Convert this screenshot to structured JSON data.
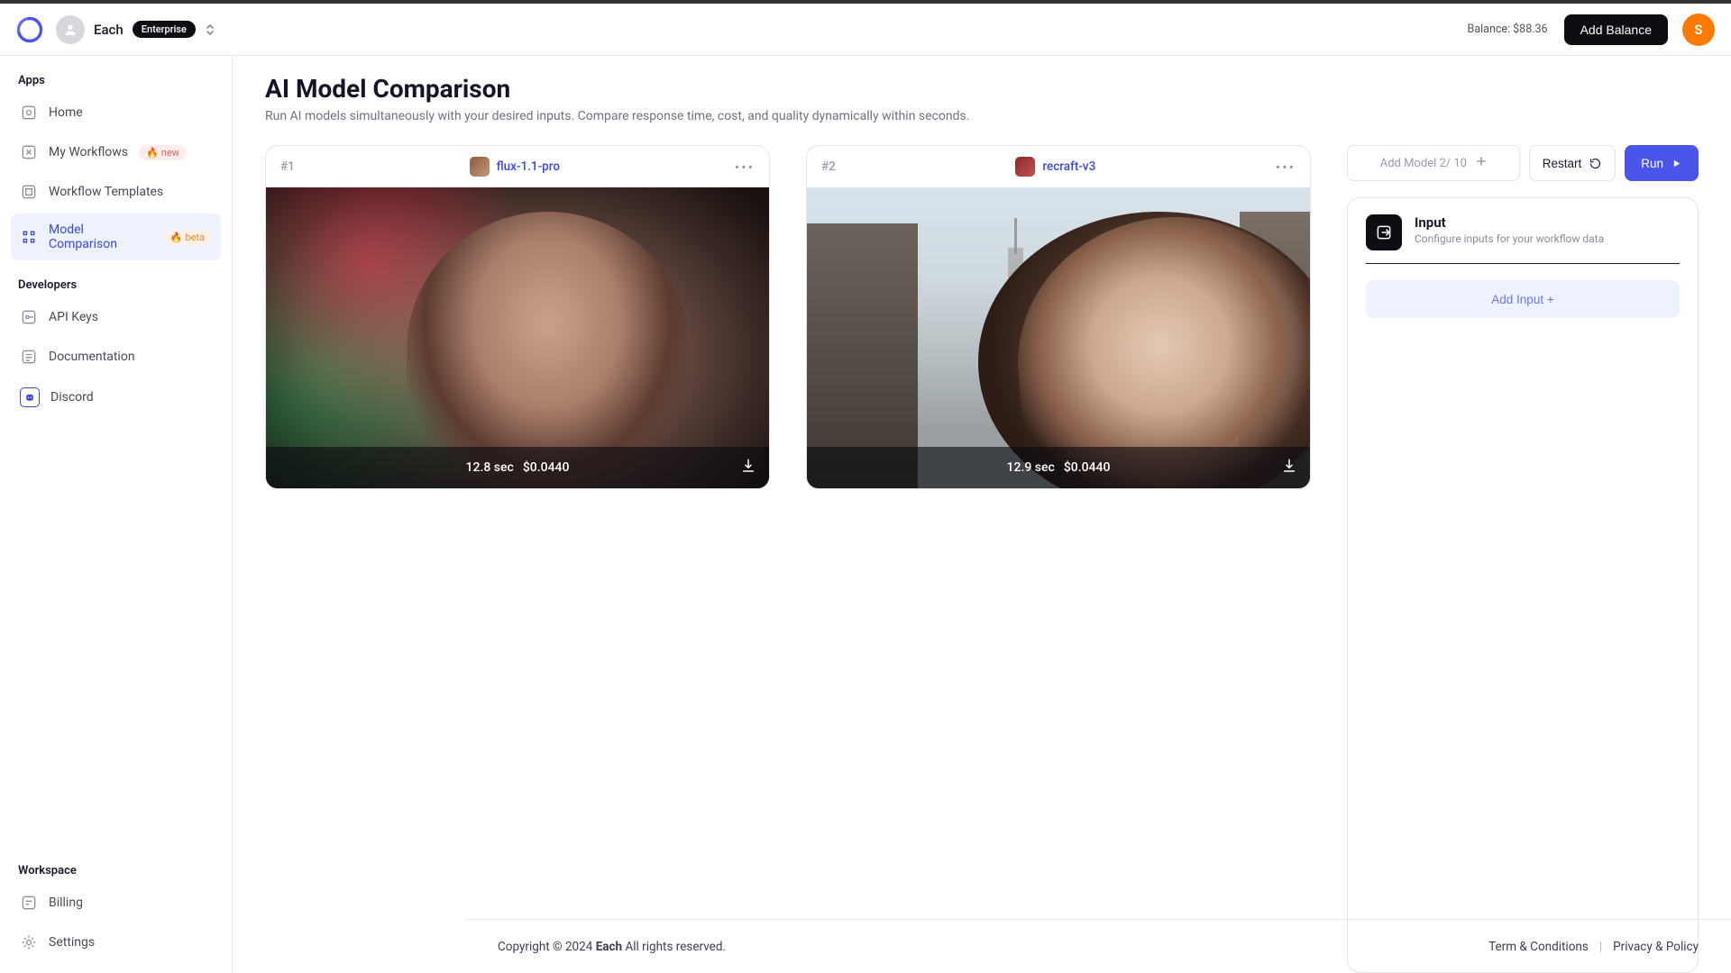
{
  "header": {
    "workspace_name": "Each",
    "plan_badge": "Enterprise",
    "balance_label": "Balance: $88.36",
    "add_balance_label": "Add Balance",
    "avatar_letter": "S",
    "avatar_color": "#ff7a00"
  },
  "sidebar": {
    "sections": {
      "apps_title": "Apps",
      "developers_title": "Developers",
      "workspace_title": "Workspace"
    },
    "items": {
      "home": "Home",
      "my_workflows": "My Workflows",
      "my_workflows_tag": "new",
      "workflow_templates": "Workflow Templates",
      "model_comparison": "Model Comparison",
      "model_comparison_tag": "beta",
      "api_keys": "API Keys",
      "documentation": "Documentation",
      "discord": "Discord",
      "billing": "Billing",
      "settings": "Settings"
    }
  },
  "page": {
    "title": "AI Model Comparison",
    "subtitle": "Run AI models simultaneously with your desired inputs. Compare response time, cost, and quality dynamically within seconds."
  },
  "cards": [
    {
      "index": "#1",
      "model_name": "flux-1.1-pro",
      "time": "12.8 sec",
      "cost": "$0.0440"
    },
    {
      "index": "#2",
      "model_name": "recraft-v3",
      "time": "12.9 sec",
      "cost": "$0.0440"
    }
  ],
  "right_panel": {
    "add_model_label": "Add Model 2/ 10",
    "restart_label": "Restart",
    "run_label": "Run",
    "input_title": "Input",
    "input_subtitle": "Configure inputs for your workflow data",
    "add_input_label": "Add Input +"
  },
  "footer": {
    "copyright_pre": "Copyright © 2024 ",
    "brand": "Each",
    "copyright_post": " All rights reserved.",
    "terms": "Term & Conditions",
    "privacy": "Privacy & Policy"
  }
}
